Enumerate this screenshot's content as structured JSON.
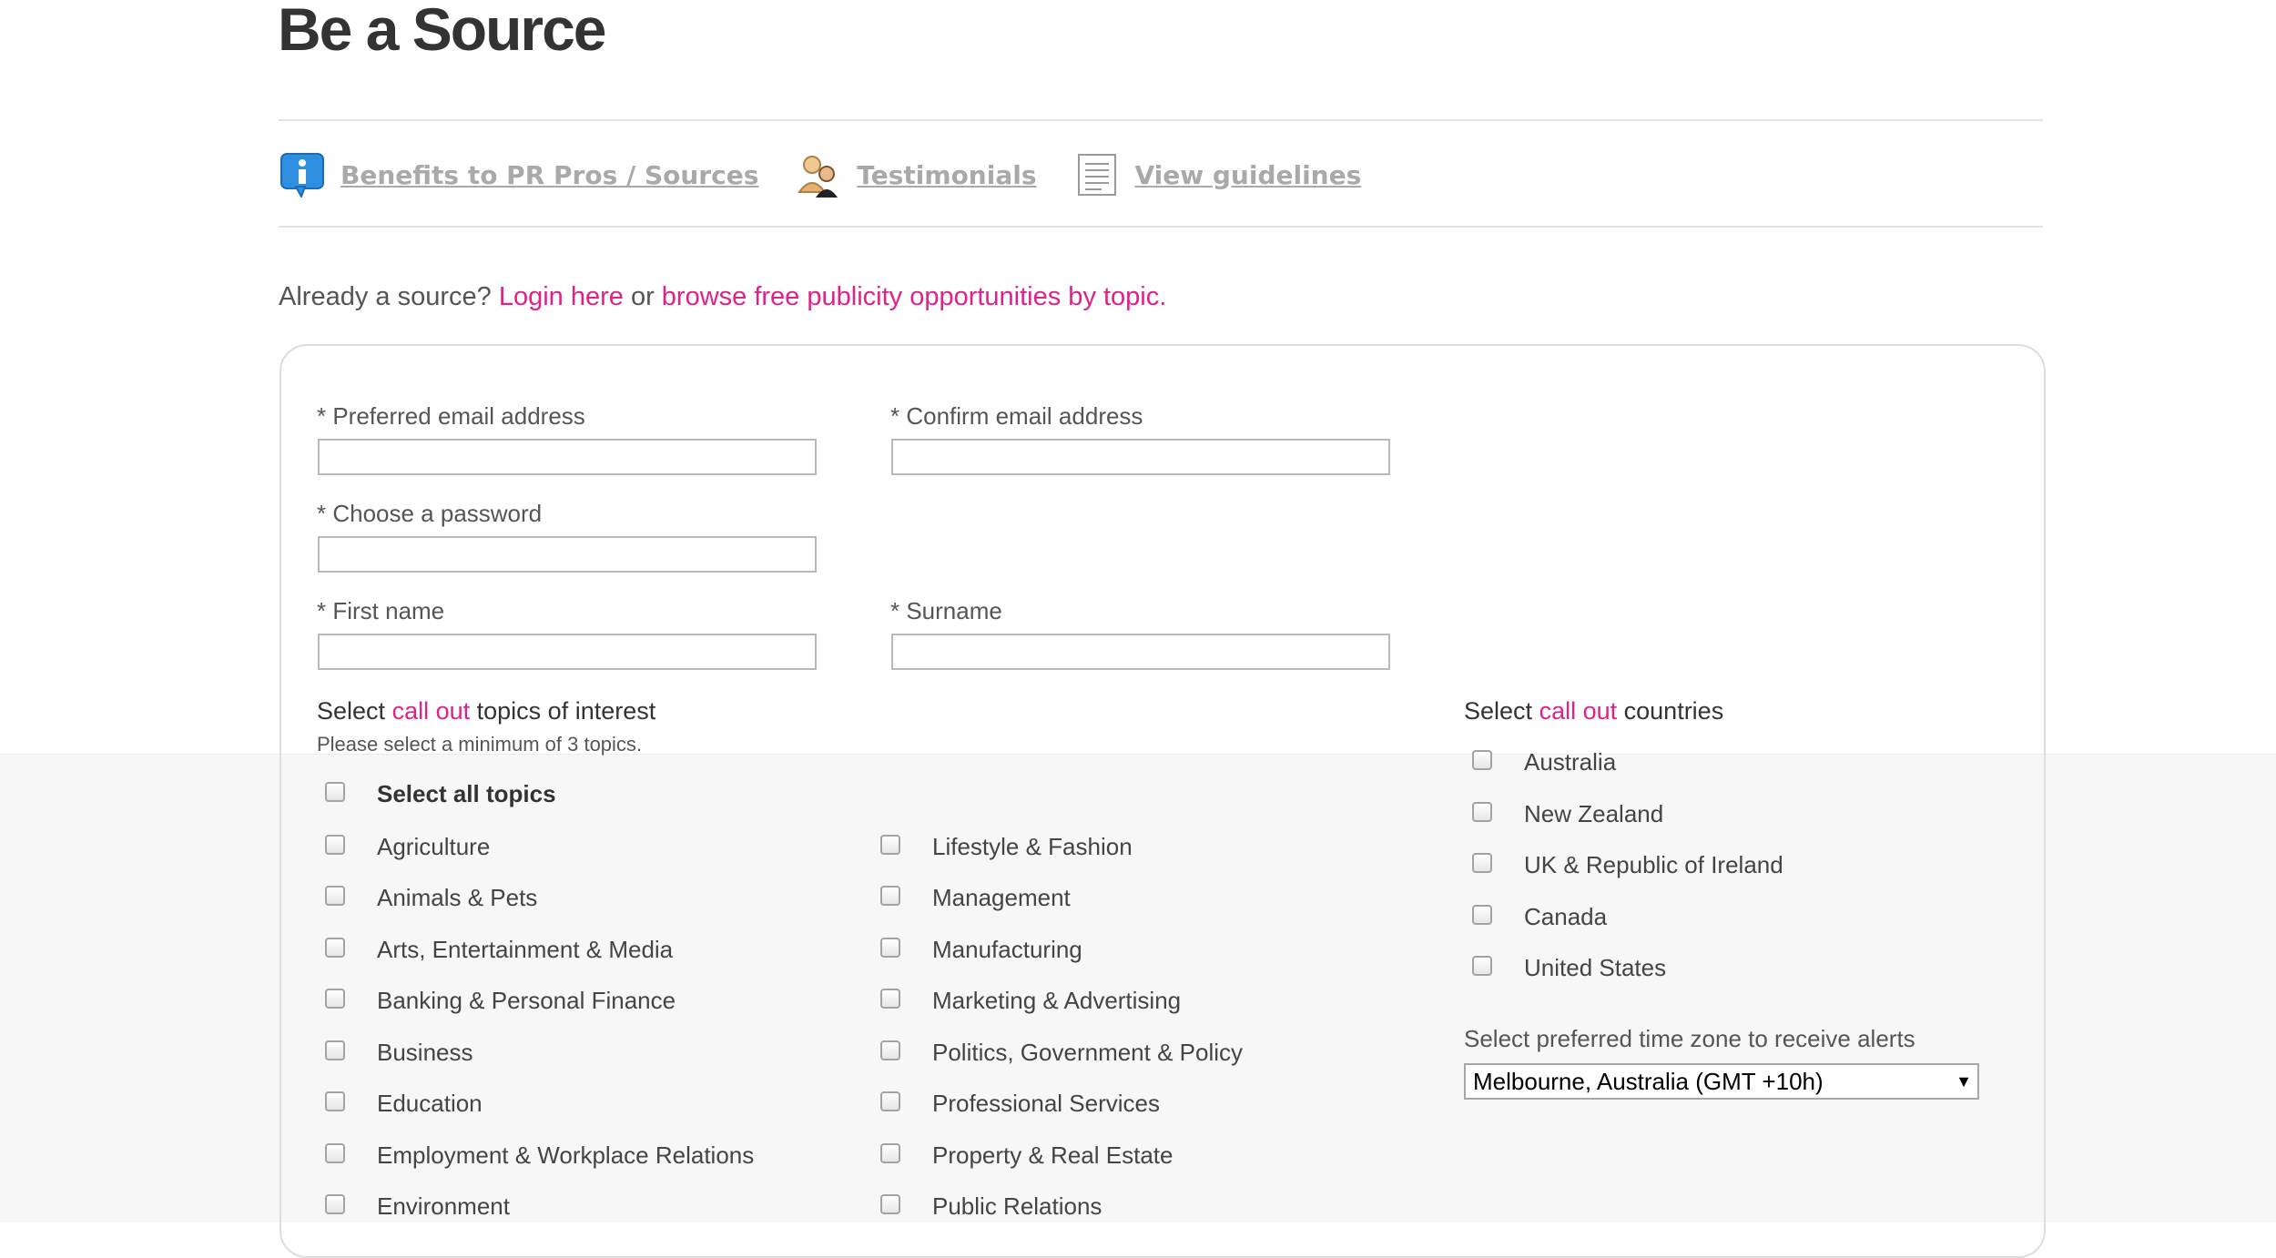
{
  "page": {
    "title": "Be a Source"
  },
  "quick_links": [
    {
      "label": "Benefits to PR Pros / Sources",
      "icon": "info-speech-icon"
    },
    {
      "label": "Testimonials",
      "icon": "people-icon"
    },
    {
      "label": "View guidelines",
      "icon": "document-icon"
    }
  ],
  "intro": {
    "prefix": "Already a source?",
    "login_link": "Login here",
    "middle": "or",
    "browse_link": "browse free publicity opportunities by topic."
  },
  "form": {
    "email_label": "* Preferred email address",
    "email_value": "",
    "confirm_email_label": "* Confirm email address",
    "confirm_email_value": "",
    "password_label": "* Choose a password",
    "password_value": "",
    "first_name_label": "* First name",
    "first_name_value": "",
    "surname_label": "* Surname",
    "surname_value": ""
  },
  "topics": {
    "title_prefix": "Select",
    "title_highlight": "call out",
    "title_suffix": "topics of interest",
    "hint": "Please select a minimum of 3 topics.",
    "select_all_label": "Select all topics",
    "column1": [
      "Agriculture",
      "Animals & Pets",
      "Arts, Entertainment & Media",
      "Banking & Personal Finance",
      "Business",
      "Education",
      "Employment & Workplace Relations",
      "Environment"
    ],
    "column2": [
      "Lifestyle & Fashion",
      "Management",
      "Manufacturing",
      "Marketing & Advertising",
      "Politics, Government & Policy",
      "Professional Services",
      "Property & Real Estate",
      "Public Relations"
    ]
  },
  "countries": {
    "title_prefix": "Select",
    "title_highlight": "call out",
    "title_suffix": "countries",
    "items": [
      "Australia",
      "New Zealand",
      "UK & Republic of Ireland",
      "Canada",
      "United States"
    ]
  },
  "timezone": {
    "label": "Select preferred time zone to receive alerts",
    "selected": "Melbourne, Australia (GMT +10h)"
  },
  "colors": {
    "accent": "#e0218a",
    "link_gray": "#a9a9a9"
  }
}
